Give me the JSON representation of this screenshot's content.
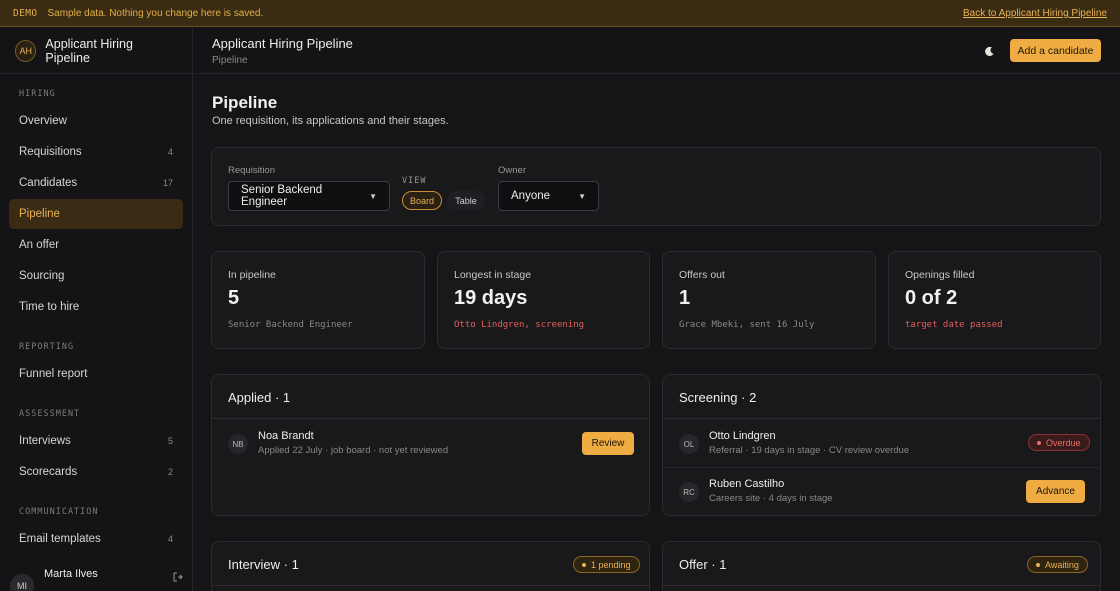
{
  "banner": {
    "tag": "DEMO",
    "message": "Sample data. Nothing you change here is saved.",
    "back_link": "Back to Applicant Hiring Pipeline"
  },
  "sidebar": {
    "brand_initials": "AH",
    "brand_title": "Applicant Hiring Pipeline",
    "sections": [
      {
        "label": "HIRING",
        "items": [
          {
            "label": "Overview",
            "count": ""
          },
          {
            "label": "Requisitions",
            "count": "4"
          },
          {
            "label": "Candidates",
            "count": "17"
          },
          {
            "label": "Pipeline",
            "count": "",
            "active": true
          },
          {
            "label": "An offer",
            "count": ""
          },
          {
            "label": "Sourcing",
            "count": ""
          },
          {
            "label": "Time to hire",
            "count": ""
          }
        ]
      },
      {
        "label": "REPORTING",
        "items": [
          {
            "label": "Funnel report",
            "count": ""
          }
        ]
      },
      {
        "label": "ASSESSMENT",
        "items": [
          {
            "label": "Interviews",
            "count": "5"
          },
          {
            "label": "Scorecards",
            "count": "2"
          }
        ]
      },
      {
        "label": "COMMUNICATION",
        "items": [
          {
            "label": "Email templates",
            "count": "4"
          }
        ]
      }
    ],
    "user": {
      "initials": "MI",
      "name": "Marta Ilves"
    }
  },
  "header": {
    "title": "Applicant Hiring Pipeline",
    "breadcrumb": "Pipeline",
    "add_button": "Add a candidate"
  },
  "page": {
    "title": "Pipeline",
    "subtitle": "One requisition, its applications and their stages."
  },
  "filters": {
    "requisition_label": "Requisition",
    "requisition_value": "Senior Backend Engineer",
    "view_label": "VIEW",
    "view_board": "Board",
    "view_table": "Table",
    "view_selected": "Board",
    "owner_label": "Owner",
    "owner_value": "Anyone"
  },
  "stats": [
    {
      "label": "In pipeline",
      "value": "5",
      "note": "Senior Backend Engineer",
      "alert": false
    },
    {
      "label": "Longest in stage",
      "value": "19 days",
      "note": "Otto Lindgren, screening",
      "alert": true
    },
    {
      "label": "Offers out",
      "value": "1",
      "note": "Grace Mbeki, sent 16 July",
      "alert": false
    },
    {
      "label": "Openings filled",
      "value": "0 of 2",
      "note": "target date passed",
      "alert": true
    }
  ],
  "columns": {
    "applied": {
      "title": "Applied · 1",
      "rows": [
        {
          "initials": "NB",
          "name": "Noa Brandt",
          "meta": "Applied 22 July · job board · not yet reviewed",
          "action": "Review"
        }
      ]
    },
    "screening": {
      "title": "Screening · 2",
      "rows": [
        {
          "initials": "OL",
          "name": "Otto Lindgren",
          "meta": "Referral · 19 days in stage · CV review overdue",
          "badge": "Overdue"
        },
        {
          "initials": "RC",
          "name": "Ruben Castilho",
          "meta": "Careers site · 4 days in stage",
          "action": "Advance"
        }
      ]
    },
    "interview": {
      "title": "Interview · 1",
      "badge": "1 pending"
    },
    "offer": {
      "title": "Offer · 1",
      "badge": "Awaiting"
    }
  },
  "colors": {
    "accent": "#eeac42",
    "alert": "#e0605a",
    "background": "#151517"
  }
}
